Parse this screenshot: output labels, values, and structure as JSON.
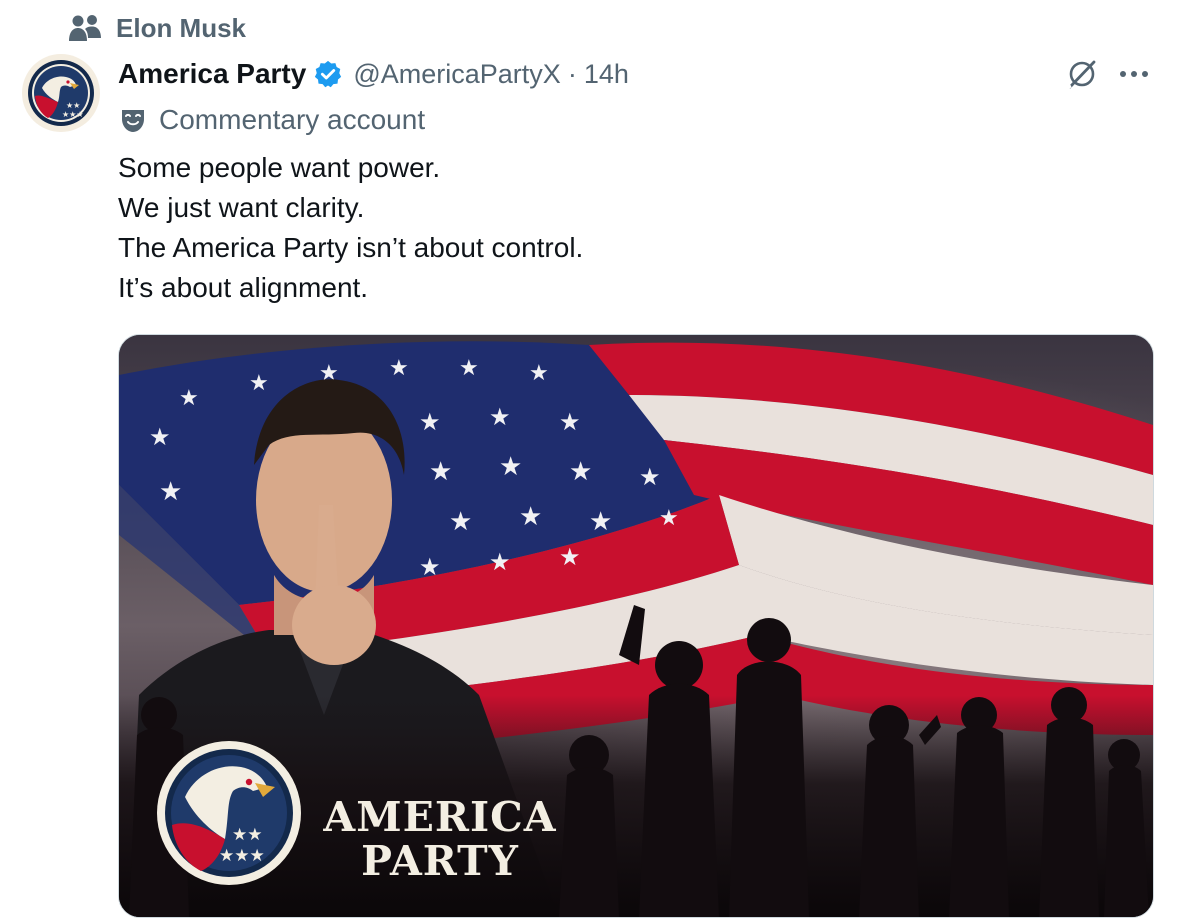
{
  "social_context": {
    "icon": "people-icon",
    "label": "Elon Musk"
  },
  "author": {
    "display_name": "America Party",
    "verified": true,
    "verified_color": "#1d9bf0",
    "handle": "@AmericaPartyX",
    "separator": "·",
    "timestamp": "14h",
    "label_icon": "theater-mask-icon",
    "label": "Commentary account"
  },
  "actions": {
    "grok_icon": "grok-icon",
    "more_icon": "more-dots-icon",
    "more_symbol": "···"
  },
  "tweet": {
    "lines": [
      "Some people want power.",
      "We just want clarity.",
      "The America Party isn’t about control.",
      "It’s about alignment."
    ]
  },
  "media": {
    "brand_line1": "AMERICA",
    "brand_line2": "PARTY",
    "colors": {
      "flag_red": "#c8102e",
      "flag_blue": "#1f2d6e",
      "navy": "#13294b",
      "cream": "#f3eee2"
    }
  },
  "colors": {
    "text_primary": "#0f1419",
    "text_secondary": "#536471",
    "border": "#cfd9de"
  }
}
